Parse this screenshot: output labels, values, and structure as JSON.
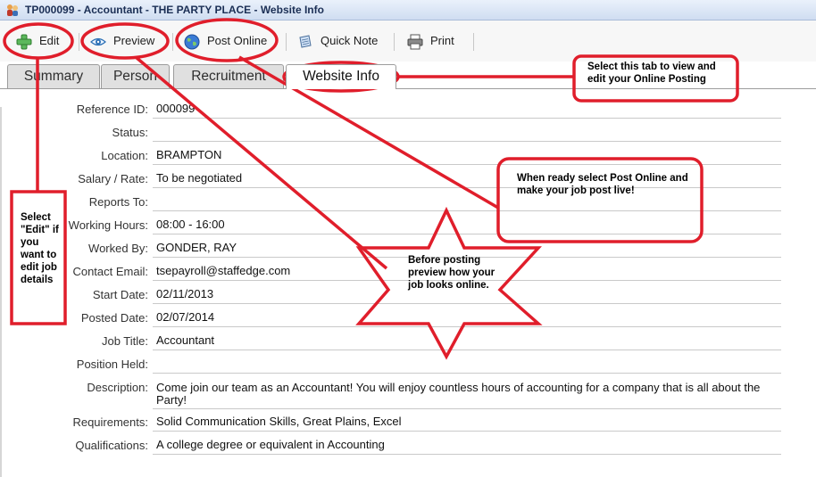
{
  "window": {
    "title": "TP000099 - Accountant - THE PARTY PLACE - Website Info"
  },
  "toolbar": {
    "edit_label": "Edit",
    "preview_label": "Preview",
    "post_online_label": "Post Online",
    "quick_note_label": "Quick Note",
    "print_label": "Print"
  },
  "tabs": [
    {
      "label": "Summary",
      "active": false
    },
    {
      "label": "Person",
      "active": false
    },
    {
      "label": "Recruitment",
      "active": false
    },
    {
      "label": "Website Info",
      "active": true
    }
  ],
  "fields": [
    {
      "label": "Reference ID:",
      "value": "000099"
    },
    {
      "label": "Status:",
      "value": ""
    },
    {
      "label": "Location:",
      "value": "BRAMPTON"
    },
    {
      "label": "Salary / Rate:",
      "value": "To be negotiated"
    },
    {
      "label": "Reports To:",
      "value": ""
    },
    {
      "label": "Working Hours:",
      "value": "08:00 - 16:00"
    },
    {
      "label": "Worked By:",
      "value": "GONDER, RAY"
    },
    {
      "label": "Contact Email:",
      "value": "tsepayroll@staffedge.com"
    },
    {
      "label": "Start Date:",
      "value": "02/11/2013"
    },
    {
      "label": "Posted Date:",
      "value": "02/07/2014"
    },
    {
      "label": "Job Title:",
      "value": "Accountant"
    },
    {
      "label": "Position Held:",
      "value": ""
    },
    {
      "label": "Description:",
      "value": "Come join our team as an Accountant!  You will enjoy countless hours of accounting for a company that is all about the Party!"
    },
    {
      "label": "Requirements:",
      "value": "Solid Communication Skills, Great Plains, Excel"
    },
    {
      "label": "Qualifications:",
      "value": "A college degree or equivalent in Accounting"
    }
  ],
  "annotations": {
    "tab_note": "Select this tab to view and edit your Online Posting",
    "post_note": "When ready select Post Online and make your job post live!",
    "preview_note": "Before posting preview how your job looks online.",
    "edit_note": "Select \"Edit\" if you want to edit job details",
    "annotation_color": "#e01e2b"
  }
}
